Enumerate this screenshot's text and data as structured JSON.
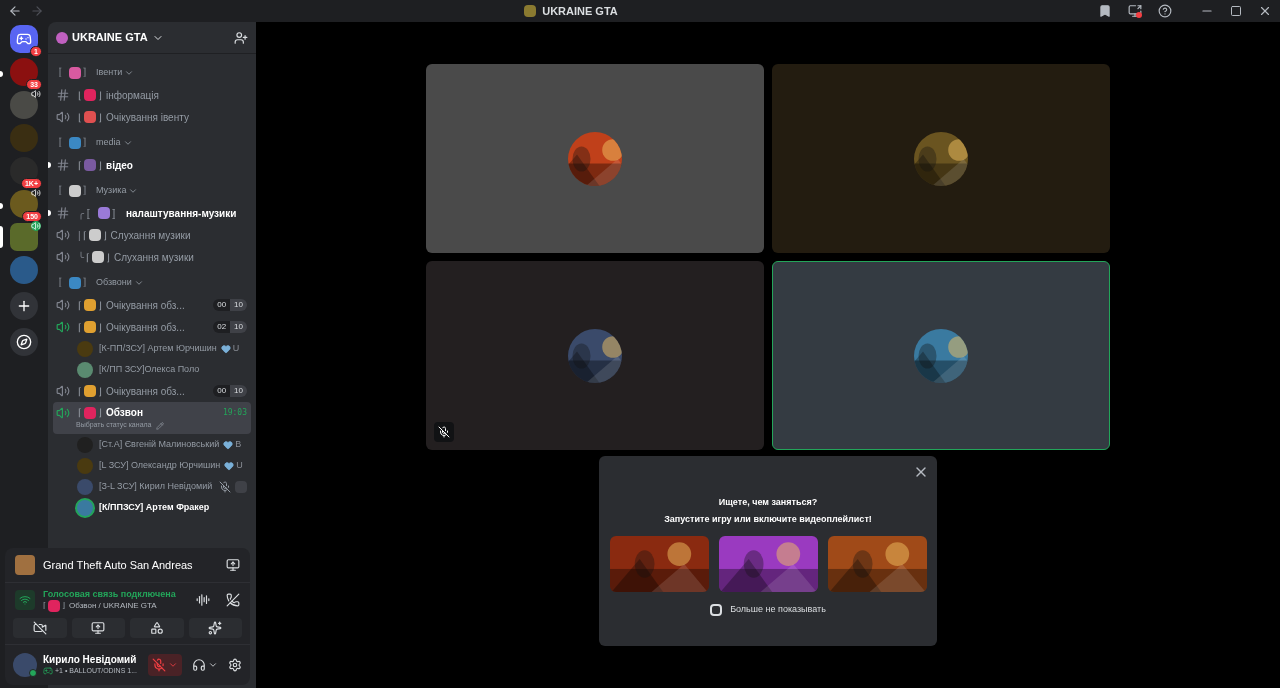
{
  "titlebar": {
    "title": "UKRAINE GTA"
  },
  "servers": [
    {
      "badge": "1",
      "unread": false,
      "selected": false,
      "speaker": false,
      "kind": "home"
    },
    {
      "badge": "33",
      "unread": true,
      "selected": false,
      "speaker": false,
      "kind": "server"
    },
    {
      "unread": false,
      "selected": false,
      "speaker": true,
      "kind": "server"
    },
    {
      "unread": false,
      "selected": false,
      "speaker": false,
      "kind": "server"
    },
    {
      "badge": "1K+",
      "unread": false,
      "selected": false,
      "speaker": false,
      "kind": "server"
    },
    {
      "badge": "150",
      "unread": true,
      "selected": false,
      "speaker": true,
      "kind": "server"
    },
    {
      "unread": false,
      "selected": true,
      "speaker": true,
      "kind": "server"
    },
    {
      "unread": false,
      "selected": false,
      "speaker": false,
      "kind": "server"
    }
  ],
  "server_header": {
    "name": "UKRAINE GTA"
  },
  "channel_list": [
    {
      "kind": "category",
      "open": "〚",
      "close": "〛",
      "color": "#d85aa0",
      "name": "Івенти"
    },
    {
      "kind": "text",
      "open": "⌊",
      "close": "⌋",
      "color": "#e0245e",
      "name": "інформація",
      "unread": false
    },
    {
      "kind": "voice",
      "open": "⌊",
      "close": "⌋",
      "color": "#e05050",
      "name": "Очікування івенту",
      "active": false,
      "selected": false
    },
    {
      "kind": "category",
      "open": "〚",
      "close": "〛",
      "color": "#3b88c3",
      "name": "media"
    },
    {
      "kind": "text",
      "open": "⌈",
      "close": "⌋",
      "color": "#7a5aa0",
      "name": "відео",
      "unread": true
    },
    {
      "kind": "category",
      "open": "〚",
      "close": "〛",
      "color": "#cccccc",
      "name": "Музика"
    },
    {
      "kind": "text",
      "lead": "╭",
      "open": "〚",
      "close": "〛",
      "color": "#9a7ad8",
      "name": "налаштування-музики",
      "unread": true
    },
    {
      "kind": "voice",
      "lead": "|",
      "open": "⌈",
      "close": "⌋",
      "color": "#cccccc",
      "name": "Слухання музики",
      "active": false,
      "selected": false
    },
    {
      "kind": "voice",
      "lead": "╰",
      "open": "⌈",
      "close": "⌋",
      "color": "#cccccc",
      "name": "Слухання музики",
      "active": false,
      "selected": false
    },
    {
      "kind": "category",
      "open": "〚",
      "close": "〛",
      "color": "#3b88c3",
      "name": "Обзвони"
    },
    {
      "kind": "voice",
      "open": "⌈",
      "close": "⌋",
      "color": "#e0a030",
      "name": "Очікування обз...",
      "count": "00",
      "limit": "10",
      "active": false,
      "selected": false
    },
    {
      "kind": "voice",
      "open": "⌈",
      "close": "⌋",
      "color": "#e0a030",
      "name": "Очікування обз...",
      "count": "02",
      "limit": "10",
      "active": true,
      "selected": false
    },
    {
      "kind": "member",
      "name": "[К-ПП/ЗСУ] Артем Юрчишин",
      "trail": "U",
      "muted": false,
      "speaking": false,
      "color": "#4a3a10"
    },
    {
      "kind": "member",
      "name": "[К/ПП ЗСУ]Олекса Поло",
      "muted": false,
      "speaking": false,
      "color": "#5a8a70"
    },
    {
      "kind": "voice",
      "open": "⌈",
      "close": "⌋",
      "color": "#e0a030",
      "name": "Очікування обз...",
      "count": "00",
      "limit": "10",
      "active": false,
      "selected": false
    },
    {
      "kind": "voice",
      "open": "⌈",
      "close": "⌋",
      "color": "#e0245e",
      "name": "Обзвон",
      "timer": "19:03",
      "status": "Выбрать статус канала",
      "active": true,
      "selected": true
    },
    {
      "kind": "member",
      "name": "[Ст.А] Євгеній Малиновський",
      "trail": "B",
      "muted": false,
      "speaking": false,
      "color": "#202020"
    },
    {
      "kind": "member",
      "name": "[L ЗСУ] Олександр Юрчишин",
      "trail": "U",
      "muted": false,
      "speaking": false,
      "color": "#4a3a10"
    },
    {
      "kind": "member",
      "name": "[З-L ЗСУ] Кирил Невідомий",
      "muted": true,
      "speaking": false,
      "color": "#3a4a6a"
    },
    {
      "kind": "member",
      "name": "[К/ППЗСУ] Артем Фракер",
      "muted": false,
      "speaking": true,
      "color": "#3a7aa0"
    }
  ],
  "activity": {
    "game": "Grand Theft Auto San Andreas"
  },
  "voice_panel": {
    "status": "Голосовая связь подключена",
    "open": "⌈",
    "close": "⌋",
    "channel": "Обзвон / UKRAINE GTA"
  },
  "user": {
    "name": "Кирило Невідомий",
    "extra": "+1 • BALLOUT/ODINS 1...",
    "mic_muted": true
  },
  "tiles": [
    {
      "speaking": false,
      "muted": false
    },
    {
      "speaking": false,
      "muted": false
    },
    {
      "speaking": false,
      "muted": true
    },
    {
      "speaking": true,
      "muted": false
    }
  ],
  "popup": {
    "title": "Ищете, чем заняться?",
    "subtitle": "Запустите игру или включите видеоплейлист!",
    "dont_show": {
      "label": "Больше не показывать",
      "checked": false
    }
  }
}
